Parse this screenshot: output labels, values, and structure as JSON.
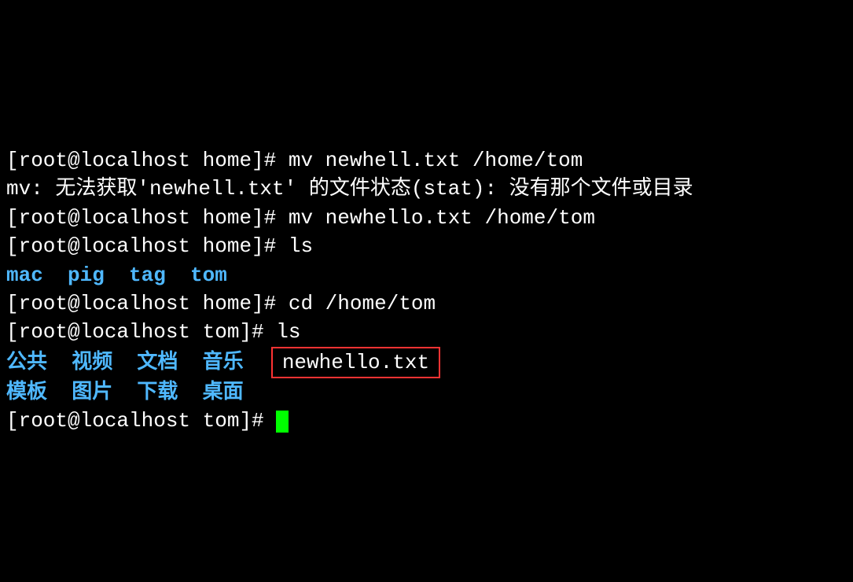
{
  "lines": {
    "l1_prompt": "[root@localhost home]# ",
    "l1_cmd": "mv newhell.txt /home/tom",
    "l2_err_a": "mv: 无法获取'newhell.txt' 的文件状态(stat): 没有那个文件或目录",
    "l3_prompt": "[root@localhost home]# ",
    "l3_cmd": "mv newhello.txt /home/tom",
    "l4_prompt": "[root@localhost home]# ",
    "l4_cmd": "ls",
    "l5_dirs": "mac  pig  tag  tom",
    "l6_prompt": "[root@localhost home]# ",
    "l6_cmd": "cd /home/tom",
    "l7_prompt": "[root@localhost tom]# ",
    "l7_cmd": "ls",
    "l8_dirs_row1": "公共  视频  文档  音乐  ",
    "l8_file": "newhello.txt",
    "l9_dirs_row2": "模板  图片  下载  桌面",
    "l10_prompt": "[root@localhost tom]# "
  }
}
